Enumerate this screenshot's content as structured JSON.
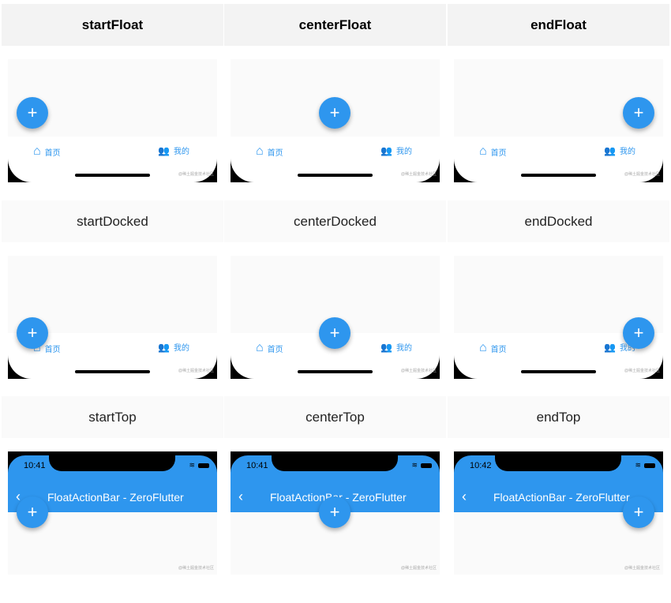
{
  "rows": [
    {
      "style": "bold",
      "labels": [
        "startFloat",
        "centerFloat",
        "endFloat"
      ],
      "variant": "float"
    },
    {
      "style": "norm",
      "labels": [
        "startDocked",
        "centerDocked",
        "endDocked"
      ],
      "variant": "docked"
    },
    {
      "style": "norm",
      "labels": [
        "startTop",
        "centerTop",
        "endTop"
      ],
      "variant": "top"
    }
  ],
  "nav": {
    "home_label": "首页",
    "mine_label": "我的"
  },
  "fab_symbol": "+",
  "watermark": "@稀土掘金技术社区",
  "appbar": {
    "title": "FloatActionBar - ZeroFlutter",
    "back": "‹",
    "times": [
      "10:41",
      "10:41",
      "10:42"
    ]
  },
  "colors": {
    "accent": "#2e96ee"
  }
}
